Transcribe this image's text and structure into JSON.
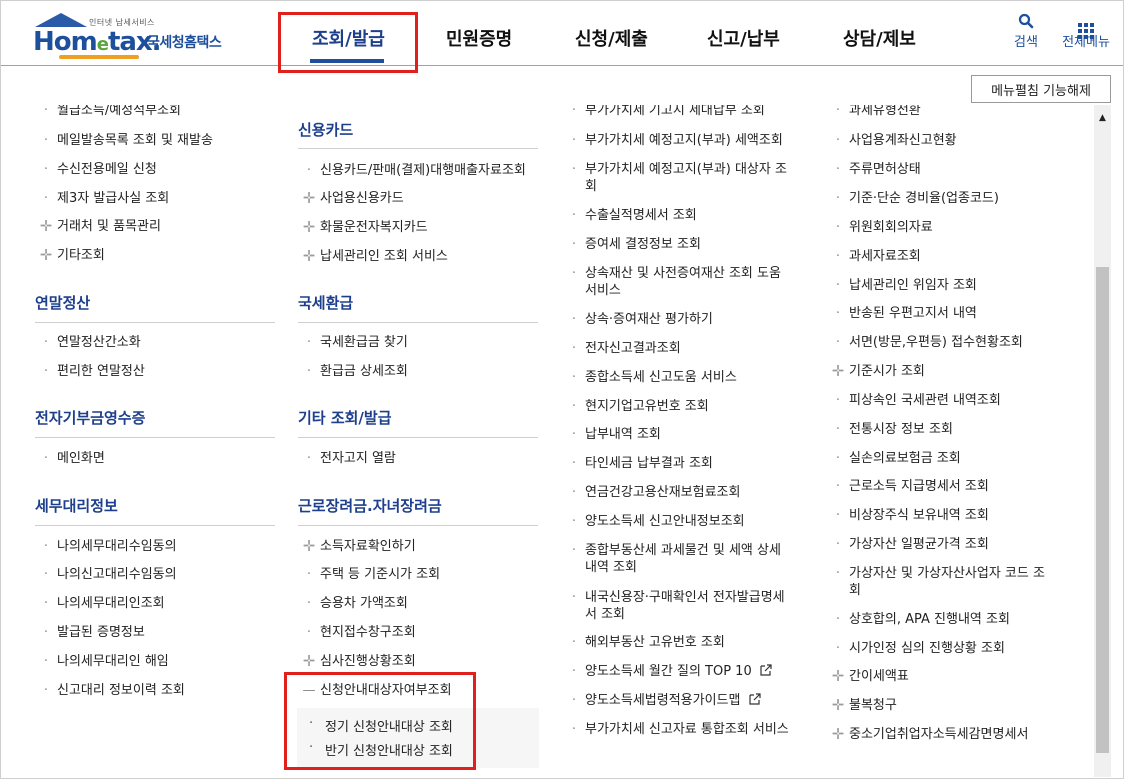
{
  "header": {
    "logo_tagline": "인터넷 납세서비스",
    "logo_main_a": "Hom",
    "logo_main_e": "e",
    "logo_main_b": "tax.",
    "logo_sub": "국세청홈택스",
    "nav": [
      "조회/발급",
      "민원증명",
      "신청/제출",
      "신고/납부",
      "상담/제보"
    ],
    "search_label": "검색",
    "allmenu_label": "전체메뉴"
  },
  "toggle_button": "메뉴펼침 기능해제",
  "col1": {
    "top_items": [
      {
        "label": "월급소득/예정적부조회",
        "icon": "dot"
      },
      {
        "label": "메일발송목록 조회 및 재발송",
        "icon": "dot"
      },
      {
        "label": "수신전용메일 신청",
        "icon": "dot"
      },
      {
        "label": "제3자 발급사실 조회",
        "icon": "dot"
      },
      {
        "label": "거래처 및 품목관리",
        "icon": "plus"
      },
      {
        "label": "기타조회",
        "icon": "plus"
      }
    ],
    "sections": [
      {
        "title": "연말정산",
        "items": [
          "연말정산간소화",
          "편리한 연말정산"
        ]
      },
      {
        "title": "전자기부금영수증",
        "items": [
          "메인화면"
        ]
      },
      {
        "title": "세무대리정보",
        "items": [
          "나의세무대리수임동의",
          "나의신고대리수임동의",
          "나의세무대리인조회",
          "발급된 증명정보",
          "나의세무대리인 해임",
          "신고대리 정보이력 조회"
        ]
      }
    ]
  },
  "col2": {
    "sections": [
      {
        "title": "신용카드",
        "items": [
          {
            "label": "신용카드/판매(결제)대행매출자료조회",
            "icon": "dot"
          },
          {
            "label": "사업용신용카드",
            "icon": "plus"
          },
          {
            "label": "화물운전자복지카드",
            "icon": "plus"
          },
          {
            "label": "납세관리인 조회 서비스",
            "icon": "plus"
          }
        ]
      },
      {
        "title": "국세환급",
        "items": [
          {
            "label": "국세환급금 찾기",
            "icon": "dot"
          },
          {
            "label": "환급금 상세조회",
            "icon": "dot"
          }
        ]
      },
      {
        "title": "기타 조회/발급",
        "items": [
          {
            "label": "전자고지 열람",
            "icon": "dot"
          }
        ]
      },
      {
        "title": "근로장려금.자녀장려금",
        "items": [
          {
            "label": "소득자료확인하기",
            "icon": "plus"
          },
          {
            "label": "주택 등 기준시가 조회",
            "icon": "dot"
          },
          {
            "label": "승용차 가액조회",
            "icon": "dot"
          },
          {
            "label": "현지접수창구조회",
            "icon": "dot"
          },
          {
            "label": "심사진행상황조회",
            "icon": "plus"
          },
          {
            "label": "신청안내대상자여부조회",
            "icon": "minus"
          }
        ]
      }
    ],
    "sub_items": [
      "정기 신청안내대상 조회",
      "반기 신청안내대상 조회"
    ]
  },
  "col3": {
    "items": [
      "부가가치세 기고지 세대납부 조회",
      "부가가치세 예정고지(부과) 세액조회",
      "부가가치세 예정고지(부과) 대상자 조\n회",
      "수출실적명세서 조회",
      "증여세 결정정보 조회",
      "상속재산 및 사전증여재산 조회 도움\n서비스",
      "상속·증여재산 평가하기",
      "전자신고결과조회",
      "종합소득세 신고도움 서비스",
      "현지기업고유번호 조회",
      "납부내역 조회",
      "타인세금 납부결과 조회",
      "연금건강고용산재보험료조회",
      "양도소득세 신고안내정보조회",
      "종합부동산세 과세물건 및 세액 상세\n내역 조회",
      "내국신용장·구매확인서 전자발급명세\n서 조회",
      "해외부동산 고유번호 조회",
      "양도소득세 월간 질의 TOP 10",
      "양도소득세법령적용가이드맵",
      "부가가치세 신고자료 통합조회 서비스"
    ],
    "external_icon": "external-link-icon"
  },
  "col4": {
    "items": [
      {
        "label": "과세유형전환",
        "icon": "dot"
      },
      {
        "label": "사업용계좌신고현황",
        "icon": "dot"
      },
      {
        "label": "주류면허상태",
        "icon": "dot"
      },
      {
        "label": "기준·단순 경비율(업종코드)",
        "icon": "dot"
      },
      {
        "label": "위원회회의자료",
        "icon": "dot"
      },
      {
        "label": "과세자료조회",
        "icon": "dot"
      },
      {
        "label": "납세관리인 위임자 조회",
        "icon": "dot"
      },
      {
        "label": "반송된 우편고지서 내역",
        "icon": "dot"
      },
      {
        "label": "서면(방문,우편등) 접수현황조회",
        "icon": "dot"
      },
      {
        "label": "기준시가 조회",
        "icon": "plus"
      },
      {
        "label": "피상속인 국세관련 내역조회",
        "icon": "dot"
      },
      {
        "label": "전통시장 정보 조회",
        "icon": "dot"
      },
      {
        "label": "실손의료보험금 조회",
        "icon": "dot"
      },
      {
        "label": "근로소득 지급명세서 조회",
        "icon": "dot"
      },
      {
        "label": "비상장주식 보유내역 조회",
        "icon": "dot"
      },
      {
        "label": "가상자산 일평균가격 조회",
        "icon": "dot"
      },
      {
        "label": "가상자산 및 가상자산사업자 코드 조\n회",
        "icon": "dot"
      },
      {
        "label": "상호합의, APA 진행내역 조회",
        "icon": "dot"
      },
      {
        "label": "시가인정 심의 진행상황 조회",
        "icon": "dot"
      },
      {
        "label": "간이세액표",
        "icon": "plus"
      },
      {
        "label": "불복청구",
        "icon": "plus"
      },
      {
        "label": "중소기업취업자소득세감면명세서",
        "icon": "plus"
      }
    ]
  },
  "colors": {
    "brand": "#1d4f9c",
    "highlight": "#e0201d"
  }
}
